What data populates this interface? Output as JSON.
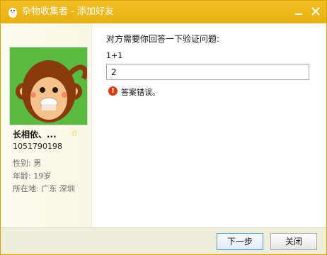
{
  "window": {
    "title": "杂物收集者 - 添加好友"
  },
  "profile": {
    "nickname": "长相依、...",
    "qq_number": "1051790198",
    "gender": "性别: 男",
    "age": "年龄: 19岁",
    "location": "所在地: 广东  深圳"
  },
  "verification": {
    "prompt": "对方需要你回答一下验证问题:",
    "question": "1+1",
    "answer_value": "2",
    "error_message": "答案错误。"
  },
  "footer": {
    "next_label": "下一步",
    "close_label": "关闭"
  },
  "colors": {
    "titlebar": "#eeb619",
    "sidebar": "#fbf9ea",
    "error": "#d93b10",
    "avatar_bg": "#5aba40"
  },
  "icons": {
    "app": "penguin-icon",
    "minimize": "minimize-icon",
    "close": "close-icon",
    "favorite": "star-icon",
    "error": "error-icon"
  }
}
